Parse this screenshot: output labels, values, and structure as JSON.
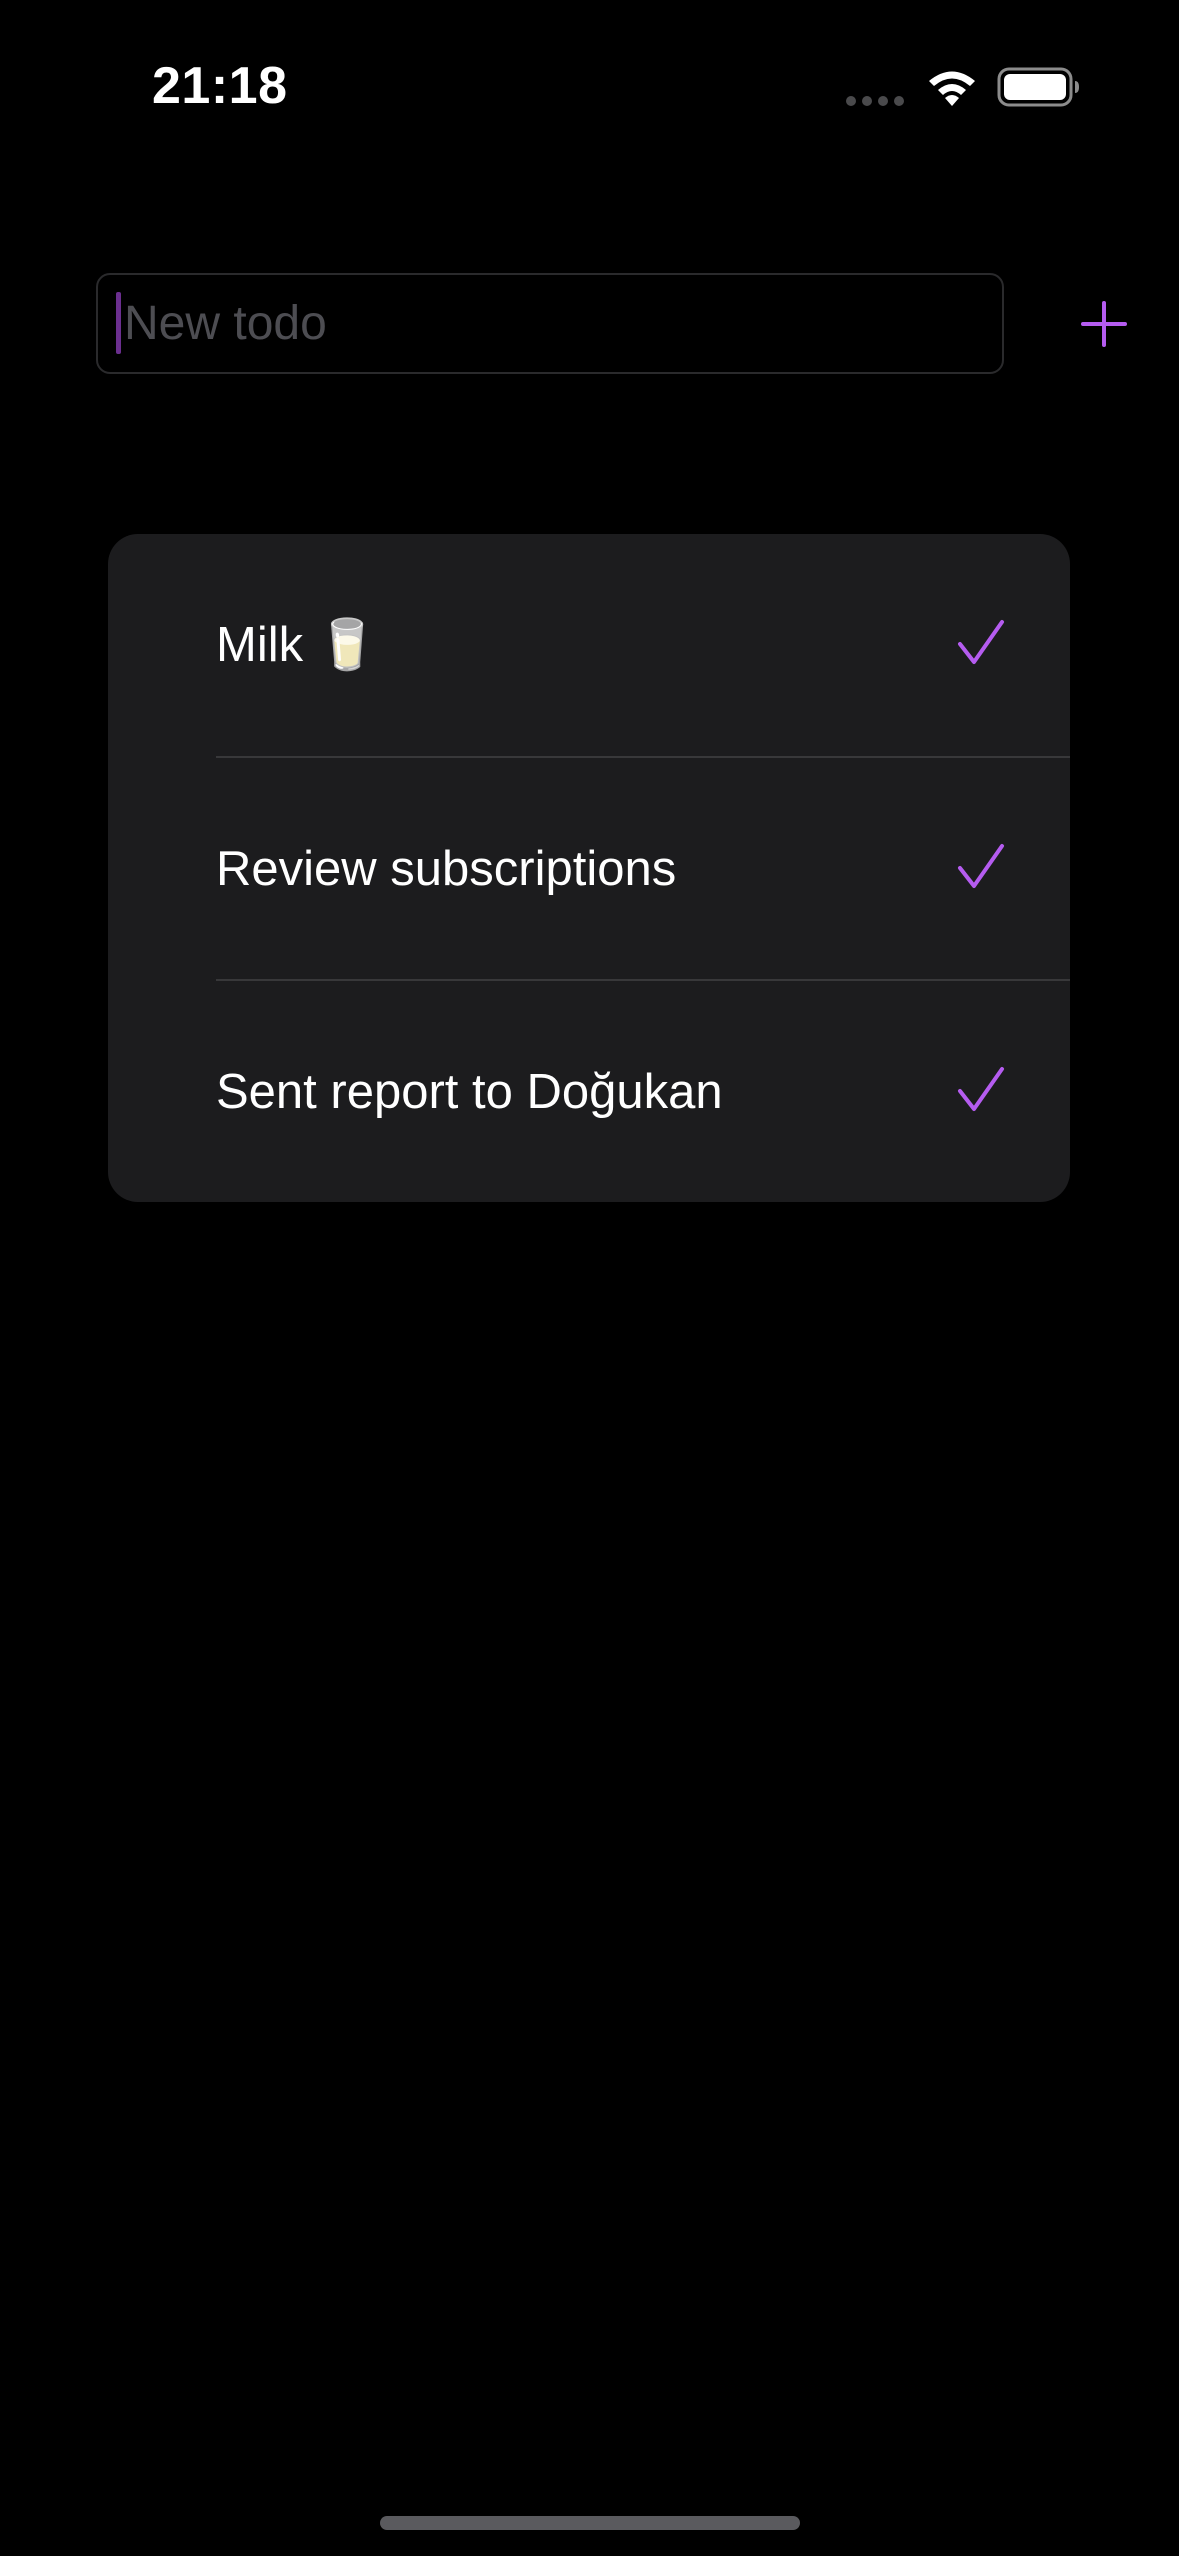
{
  "status_bar": {
    "time": "21:18",
    "icons": [
      "signal-dots-icon",
      "wifi-icon",
      "battery-icon"
    ]
  },
  "new_todo": {
    "placeholder": "New todo",
    "value": "",
    "add_icon": "plus-icon"
  },
  "todos": [
    {
      "label": "Milk 🥛",
      "done": true
    },
    {
      "label": "Review subscriptions",
      "done": true
    },
    {
      "label": "Sent report to Doğukan",
      "done": true
    }
  ],
  "colors": {
    "accent": "#b55cf0",
    "background": "#000000",
    "card": "#1c1c1e",
    "separator": "#38383a",
    "placeholder": "#4d4d52"
  }
}
